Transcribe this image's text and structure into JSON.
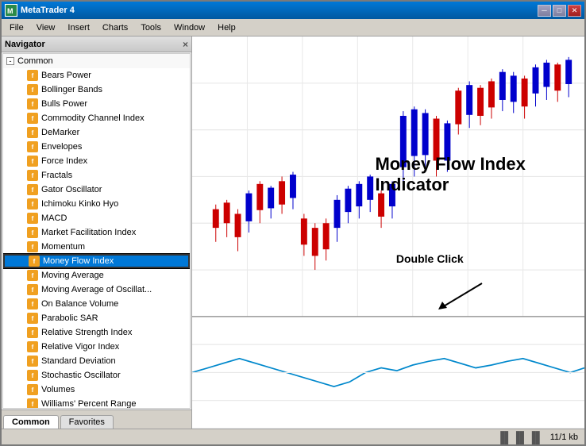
{
  "window": {
    "title": "MetaTrader 4",
    "icon": "MT4"
  },
  "titlebar": {
    "min": "─",
    "max": "□",
    "close": "✕"
  },
  "menu": {
    "items": [
      "File",
      "View",
      "Insert",
      "Charts",
      "Tools",
      "Window",
      "Help"
    ]
  },
  "navigator": {
    "title": "Navigator",
    "tabs": [
      {
        "label": "Common",
        "active": true
      },
      {
        "label": "Favorites",
        "active": false
      }
    ],
    "section_label": "Common",
    "expand_symbol": "-",
    "indicators": [
      "Bears Power",
      "Bollinger Bands",
      "Bulls Power",
      "Commodity Channel Index",
      "DeMarker",
      "Envelopes",
      "Force Index",
      "Fractals",
      "Gator Oscillator",
      "Ichimoku Kinko Hyo",
      "MACD",
      "Market Facilitation Index",
      "Momentum",
      "Money Flow Index",
      "Moving Average",
      "Moving Average of Oscillat...",
      "On Balance Volume",
      "Parabolic SAR",
      "Relative Strength Index",
      "Relative Vigor Index",
      "Standard Deviation",
      "Stochastic Oscillator",
      "Volumes",
      "Williams' Percent Range"
    ],
    "selected_index": 13
  },
  "chart": {
    "annotation_line1": "Money Flow Index",
    "annotation_line2": "Indicator",
    "double_click_label": "Double Click"
  },
  "statusbar": {
    "chart_icon": "▐▌▐▌▐▌",
    "size": "11/1 kb"
  }
}
